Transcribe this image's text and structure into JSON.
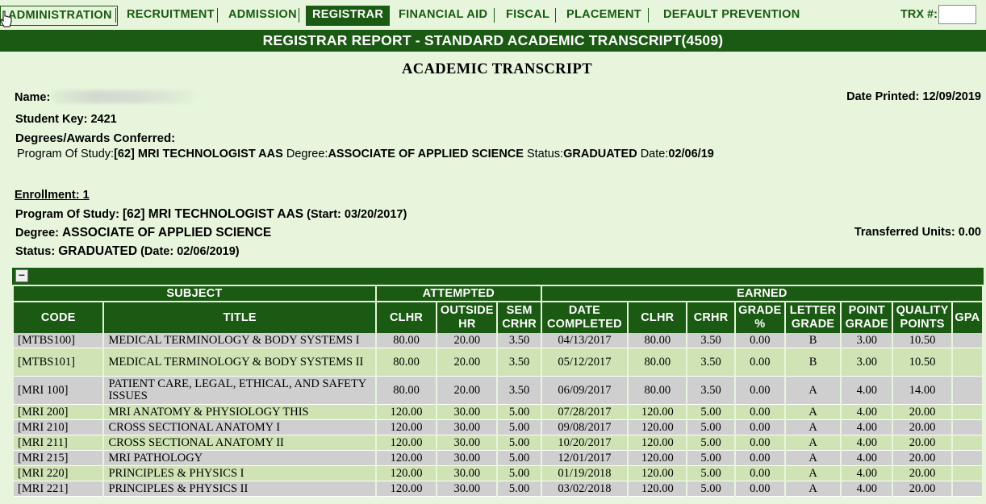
{
  "nav": {
    "items": [
      {
        "label": "ADMINISTRATION"
      },
      {
        "label": "RECRUITMENT"
      },
      {
        "label": "ADMISSION"
      },
      {
        "label": "REGISTRAR"
      },
      {
        "label": "FINANCIAL AID"
      },
      {
        "label": "FISCAL"
      },
      {
        "label": "PLACEMENT"
      },
      {
        "label": "DEFAULT PREVENTION"
      }
    ],
    "trx_label": "TRX #:",
    "trx_value": ""
  },
  "title_bar": "REGISTRAR REPORT - STANDARD ACADEMIC TRANSCRIPT(4509)",
  "doc": {
    "heading": "ACADEMIC TRANSCRIPT",
    "name_label": "Name:",
    "date_printed_label": "Date Printed:",
    "date_printed": "12/09/2019",
    "student_key_label": "Student Key:",
    "student_key": "2421",
    "degrees_label": "Degrees/Awards Conferred:",
    "program_label": "Program Of Study:",
    "program": "[62] MRI TECHNOLOGIST AAS",
    "degree_label": "Degree:",
    "degree": "ASSOCIATE OF APPLIED SCIENCE",
    "status_label": "Status:",
    "status": "GRADUATED",
    "date_label": "Date:",
    "date": "02/06/19"
  },
  "enrollment": {
    "label": "Enrollment: 1",
    "program_label": "Program Of Study:",
    "program": "[62] MRI TECHNOLOGIST AAS",
    "start_open": "(Start:",
    "start": "03/20/2017",
    "start_close": ")",
    "degree_label": "Degree:",
    "degree": "ASSOCIATE OF APPLIED SCIENCE",
    "transferred_label": "Transferred Units:",
    "transferred": "0.00",
    "status_label": "Status:",
    "status": "GRADUATED",
    "status_date_open": "(Date:",
    "status_date": "02/06/2019",
    "status_date_close": ")"
  },
  "table": {
    "collapse_symbol": "−",
    "group_headers": {
      "subject": "SUBJECT",
      "attempted": "ATTEMPTED",
      "earned": "EARNED"
    },
    "columns": {
      "code": "CODE",
      "title": "TITLE",
      "clhr": "CLHR",
      "outside_hr_1": "OUTSIDE",
      "outside_hr_2": "HR",
      "sem_crhr_1": "SEM",
      "sem_crhr_2": "CRHR",
      "date_1": "DATE",
      "date_2": "COMPLETED",
      "earned_clhr": "CLHR",
      "crhr": "CRHR",
      "grade_pct_1": "GRADE",
      "grade_pct_2": "%",
      "letter_1": "LETTER",
      "letter_2": "GRADE",
      "point_1": "POINT",
      "point_2": "GRADE",
      "quality_1": "QUALITY",
      "quality_2": "POINTS",
      "gpa": "GPA"
    },
    "rows": [
      {
        "code": "[MTBS100]",
        "title": "MEDICAL TERMINOLOGY & BODY SYSTEMS I",
        "clhr": "80.00",
        "outside": "20.00",
        "sem": "3.50",
        "date": "04/13/2017",
        "eclhr": "80.00",
        "crhr": "3.50",
        "pct": "0.00",
        "letter": "B",
        "point": "3.00",
        "quality": "10.50",
        "gpa": ""
      },
      {
        "code": "[MTBS101]",
        "title": "MEDICAL TERMINOLOGY & BODY SYSTEMS II",
        "clhr": "80.00",
        "outside": "20.00",
        "sem": "3.50",
        "date": "05/12/2017",
        "eclhr": "80.00",
        "crhr": "3.50",
        "pct": "0.00",
        "letter": "B",
        "point": "3.00",
        "quality": "10.50",
        "gpa": ""
      },
      {
        "code": "[MRI 100]",
        "title": "PATIENT CARE, LEGAL, ETHICAL, AND SAFETY ISSUES",
        "clhr": "80.00",
        "outside": "20.00",
        "sem": "3.50",
        "date": "06/09/2017",
        "eclhr": "80.00",
        "crhr": "3.50",
        "pct": "0.00",
        "letter": "A",
        "point": "4.00",
        "quality": "14.00",
        "gpa": ""
      },
      {
        "code": "[MRI 200]",
        "title": "MRI ANATOMY & PHYSIOLOGY THIS",
        "clhr": "120.00",
        "outside": "30.00",
        "sem": "5.00",
        "date": "07/28/2017",
        "eclhr": "120.00",
        "crhr": "5.00",
        "pct": "0.00",
        "letter": "A",
        "point": "4.00",
        "quality": "20.00",
        "gpa": ""
      },
      {
        "code": "[MRI 210]",
        "title": "CROSS SECTIONAL ANATOMY I",
        "clhr": "120.00",
        "outside": "30.00",
        "sem": "5.00",
        "date": "09/08/2017",
        "eclhr": "120.00",
        "crhr": "5.00",
        "pct": "0.00",
        "letter": "A",
        "point": "4.00",
        "quality": "20.00",
        "gpa": ""
      },
      {
        "code": "[MRI 211]",
        "title": "CROSS SECTIONAL ANATOMY II",
        "clhr": "120.00",
        "outside": "30.00",
        "sem": "5.00",
        "date": "10/20/2017",
        "eclhr": "120.00",
        "crhr": "5.00",
        "pct": "0.00",
        "letter": "A",
        "point": "4.00",
        "quality": "20.00",
        "gpa": ""
      },
      {
        "code": "[MRI 215]",
        "title": "MRI PATHOLOGY",
        "clhr": "120.00",
        "outside": "30.00",
        "sem": "5.00",
        "date": "12/01/2017",
        "eclhr": "120.00",
        "crhr": "5.00",
        "pct": "0.00",
        "letter": "A",
        "point": "4.00",
        "quality": "20.00",
        "gpa": ""
      },
      {
        "code": "[MRI 220]",
        "title": "PRINCIPLES & PHYSICS I",
        "clhr": "120.00",
        "outside": "30.00",
        "sem": "5.00",
        "date": "01/19/2018",
        "eclhr": "120.00",
        "crhr": "5.00",
        "pct": "0.00",
        "letter": "A",
        "point": "4.00",
        "quality": "20.00",
        "gpa": ""
      },
      {
        "code": "[MRI 221]",
        "title": "PRINCIPLES & PHYSICS II",
        "clhr": "120.00",
        "outside": "30.00",
        "sem": "5.00",
        "date": "03/02/2018",
        "eclhr": "120.00",
        "crhr": "5.00",
        "pct": "0.00",
        "letter": "A",
        "point": "4.00",
        "quality": "20.00",
        "gpa": ""
      }
    ]
  }
}
